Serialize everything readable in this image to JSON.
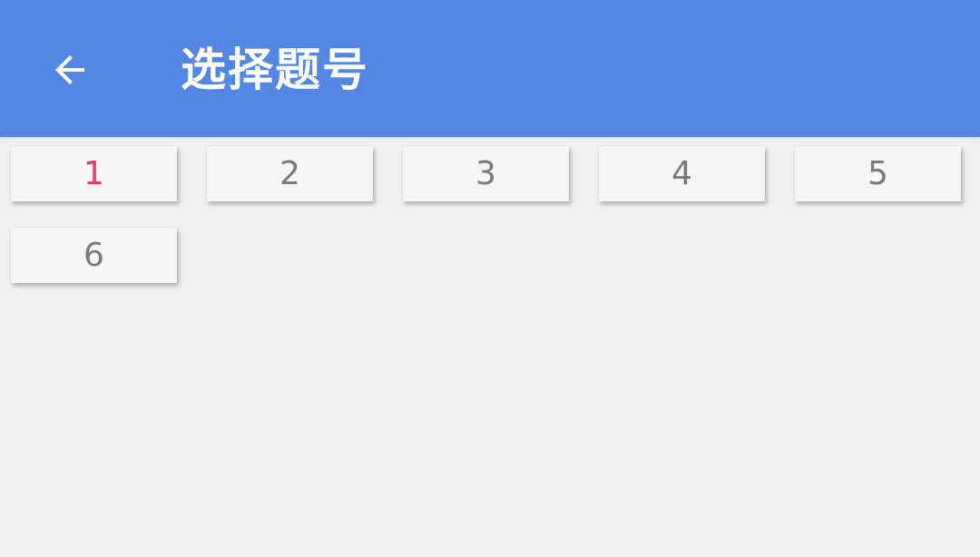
{
  "toolbar": {
    "back_icon": "arrow-back-icon",
    "title": "选择题号",
    "background_color": "#5486e3"
  },
  "questions": {
    "selected": "1",
    "selected_color": "#e63a72",
    "items": [
      {
        "label": "1"
      },
      {
        "label": "2"
      },
      {
        "label": "3"
      },
      {
        "label": "4"
      },
      {
        "label": "5"
      },
      {
        "label": "6"
      }
    ]
  }
}
